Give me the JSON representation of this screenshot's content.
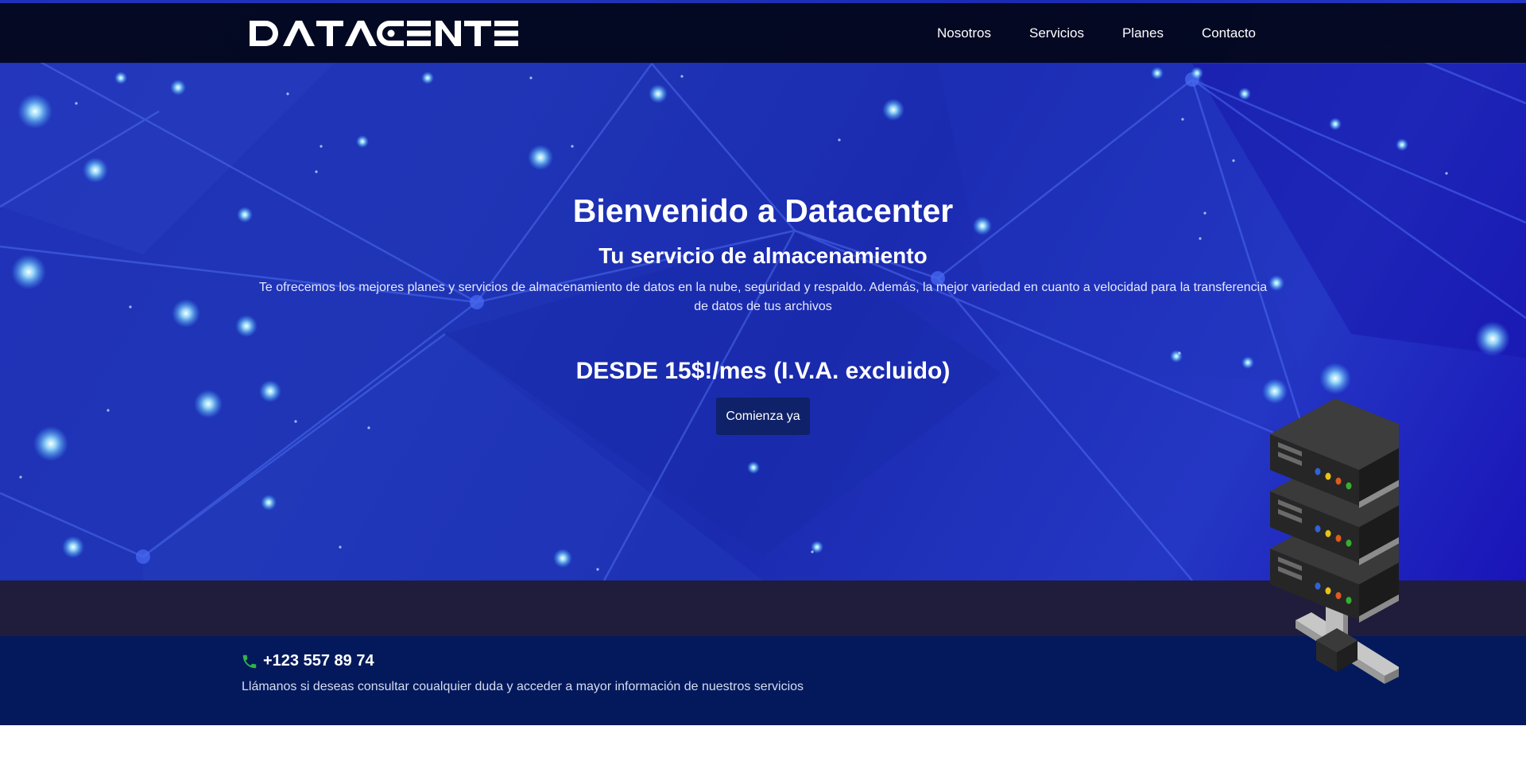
{
  "navbar": {
    "logo_text": "DATACENTER",
    "links": [
      "Nosotros",
      "Servicios",
      "Planes",
      "Contacto"
    ]
  },
  "hero": {
    "title": "Bienvenido a Datacenter",
    "subtitle": "Tu servicio de almacenamiento",
    "description": "Te ofrecemos los mejores planes y servicios de almacenamiento de datos en la nube, seguridad y respaldo. Además, la mejor variedad en cuanto a velocidad para la transferencia de datos de tus archivos",
    "price": "DESDE 15$!/mes (I.V.A. excluido)",
    "cta_label": "Comienza ya"
  },
  "contact": {
    "phone": "+123 557 89 74",
    "note": "Llámanos si deseas consultar coualquier duda y acceder a mayor información de nuestros servicios"
  },
  "icons": {
    "phone": "phone-icon",
    "server": "server-rack-illustration"
  },
  "colors": {
    "navbar_bg": "#05081b",
    "hero_blue": "#1f35b6",
    "band": "#1f1c3c",
    "contact_bg": "#03195b",
    "cta_bg": "#0f2168",
    "phone_icon": "#2fb34a"
  }
}
